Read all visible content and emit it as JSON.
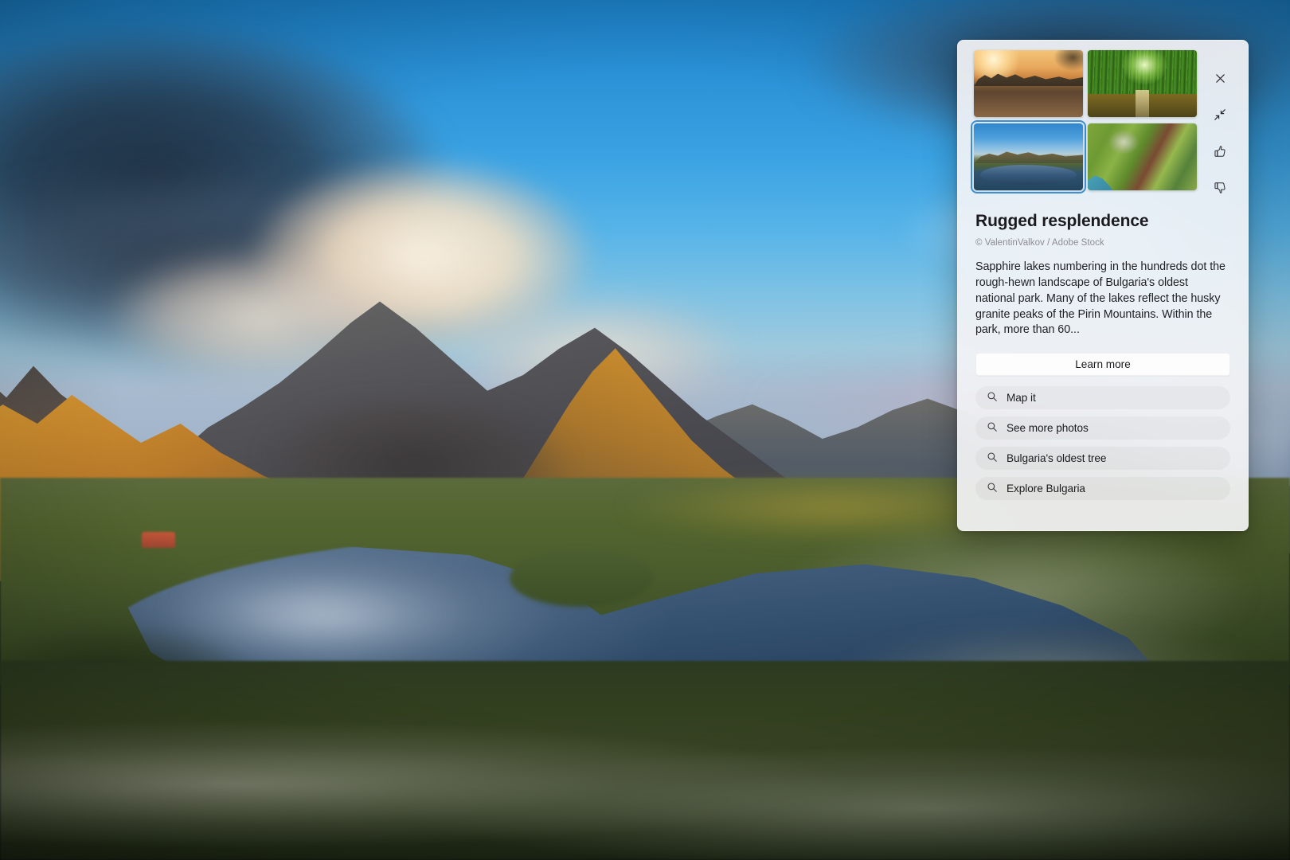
{
  "wallpaper": {
    "alt": "Sapphire alpine lake below golden-lit granite peaks, Pirin National Park, Bulgaria"
  },
  "spotlight": {
    "thumbnails": [
      {
        "name": "karst-sunrise-reflection",
        "art_class": "art-sunrise",
        "selected": false
      },
      {
        "name": "bamboo-grove-path",
        "art_class": "art-bamboo",
        "selected": false
      },
      {
        "name": "alpine-lake-pirin",
        "art_class": "art-alpine",
        "selected": true
      },
      {
        "name": "aerial-patchwork-fields",
        "art_class": "art-fields",
        "selected": false
      }
    ],
    "rail": [
      {
        "icon": "close-icon",
        "label": "Close"
      },
      {
        "icon": "collapse-icon",
        "label": "Collapse"
      },
      {
        "icon": "thumbs-up-icon",
        "label": "Like"
      },
      {
        "icon": "thumbs-down-icon",
        "label": "Dislike"
      }
    ],
    "title": "Rugged resplendence",
    "credit": "© ValentinValkov / Adobe Stock",
    "description": "Sapphire lakes numbering in the hundreds dot the rough-hewn landscape of Bulgaria's oldest national park. Many of the lakes reflect the husky granite peaks of the Pirin Mountains. Within the park, more than 60...",
    "learn_more_label": "Learn more",
    "search_suggestions": [
      {
        "label": "Map it",
        "icon": "search-icon"
      },
      {
        "label": "See more photos",
        "icon": "search-icon"
      },
      {
        "label": "Bulgaria's oldest tree",
        "icon": "search-icon"
      },
      {
        "label": "Explore Bulgaria",
        "icon": "search-icon"
      }
    ],
    "colors": {
      "panel_background": "#f3f3f5",
      "selection_ring": "#3b8fd4",
      "title_text": "#1b1b1f",
      "credit_text": "#8d8d93",
      "body_text": "#1f1f23",
      "chip_background": "#ebebed",
      "learn_more_background": "#fdfdfd"
    }
  }
}
